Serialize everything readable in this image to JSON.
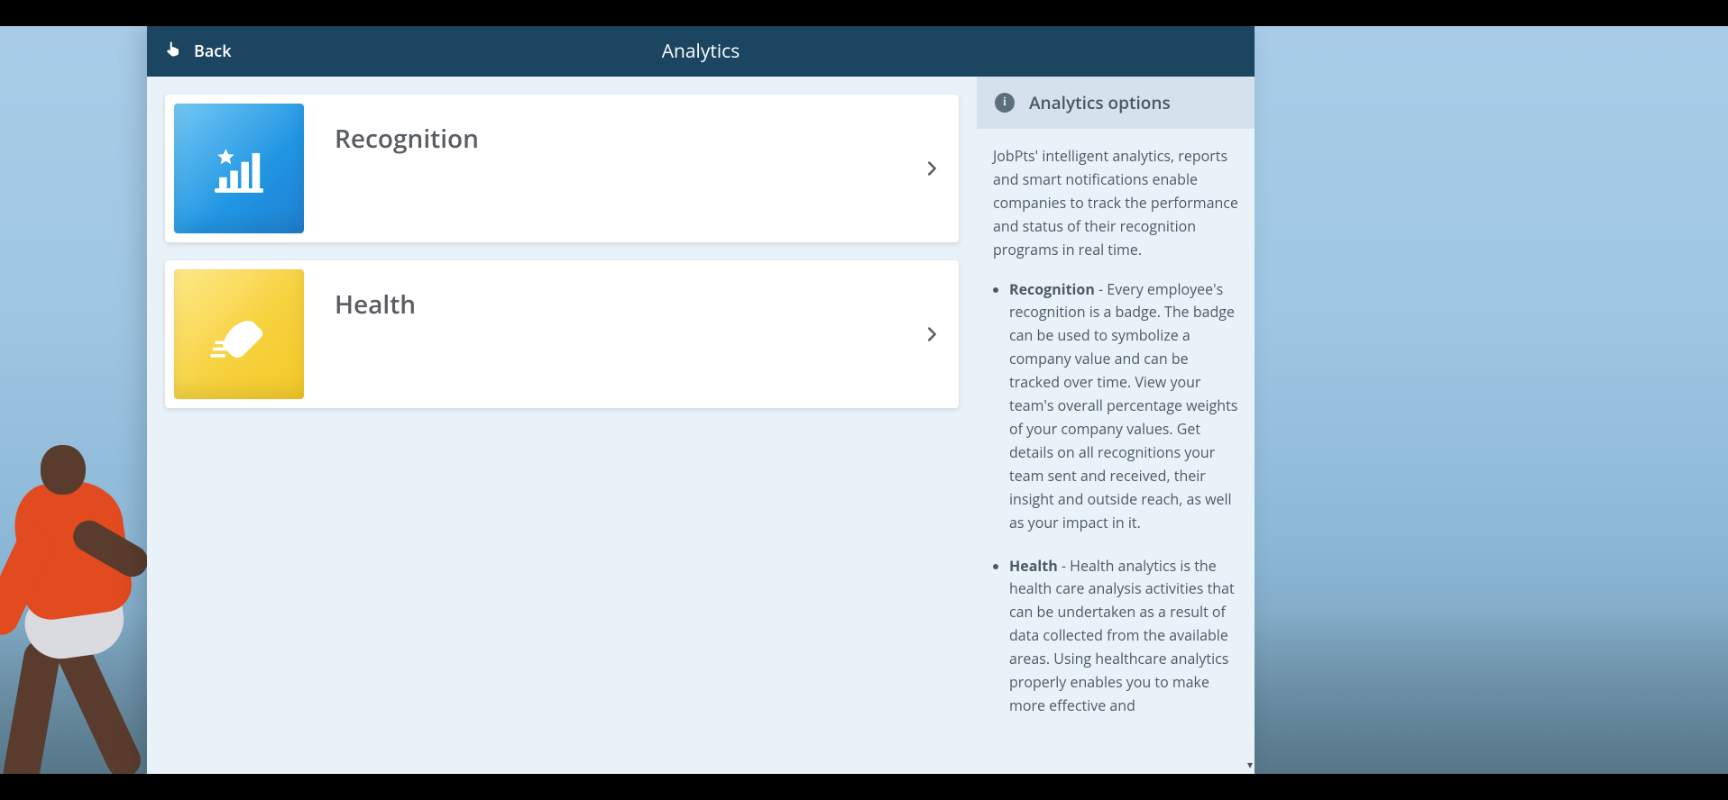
{
  "header": {
    "back_label": "Back",
    "title": "Analytics"
  },
  "cards": [
    {
      "id": "recognition",
      "label": "Recognition",
      "icon": "chart-star-icon"
    },
    {
      "id": "health",
      "label": "Health",
      "icon": "sneaker-icon"
    }
  ],
  "sidebar": {
    "title": "Analytics options",
    "intro": "JobPts' intelligent analytics, reports and smart notifications enable companies to track the performance and status of their recognition programs in real time.",
    "bullets": [
      {
        "title": "Recognition",
        "text": " - Every employee's recognition is a badge. The badge can be used to symbolize a company value and can be tracked over time. View your team's overall percentage weights of your company values. Get details on all recognitions your team sent and received, their insight and outside reach, as well as your impact in it."
      },
      {
        "title": "Health",
        "text": " - Health analytics is the health care analysis activities that can be undertaken as a result of data collected from the available areas. Using healthcare analytics properly enables you to make more effective and"
      }
    ]
  }
}
